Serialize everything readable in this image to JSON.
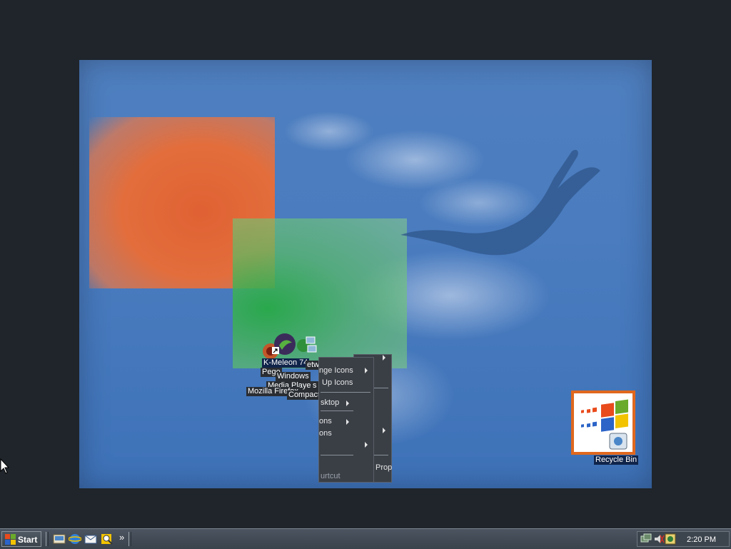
{
  "desktop": {
    "icons": {
      "kmeleon_label": "K-Meleon 74",
      "pegasus_label": "Pego",
      "network_label": "etwo",
      "windows_media_label_line1": "Windows",
      "windows_media_label_line2": "Media Player",
      "media_suffix": "s",
      "mozilla_firefox_label": "Mozilla Firefox",
      "compact_label": "Compact"
    },
    "recycle_bin_label": "Recycle Bin"
  },
  "context_menus": {
    "menu_a": {
      "items": [
        "nge Icons",
        "Up Icons",
        "sktop",
        "ons",
        "ons",
        "urtcut"
      ]
    },
    "menu_b": {
      "items": [
        "Prop"
      ]
    }
  },
  "taskbar": {
    "start_label": "Start",
    "quick_launch": [
      "show-desktop-icon",
      "internet-explorer-icon",
      "outlook-express-icon",
      "search-icon"
    ],
    "overflow_label": "»",
    "tray_icons": [
      "network-icon",
      "volume-icon",
      "security-icon"
    ],
    "clock": "2:20 PM"
  },
  "colors": {
    "wallpaper_blue": "#4a7cbf",
    "orange": "#e8602c",
    "green": "#28aa46",
    "taskbar": "#3a424c",
    "selection": "#10244a"
  }
}
